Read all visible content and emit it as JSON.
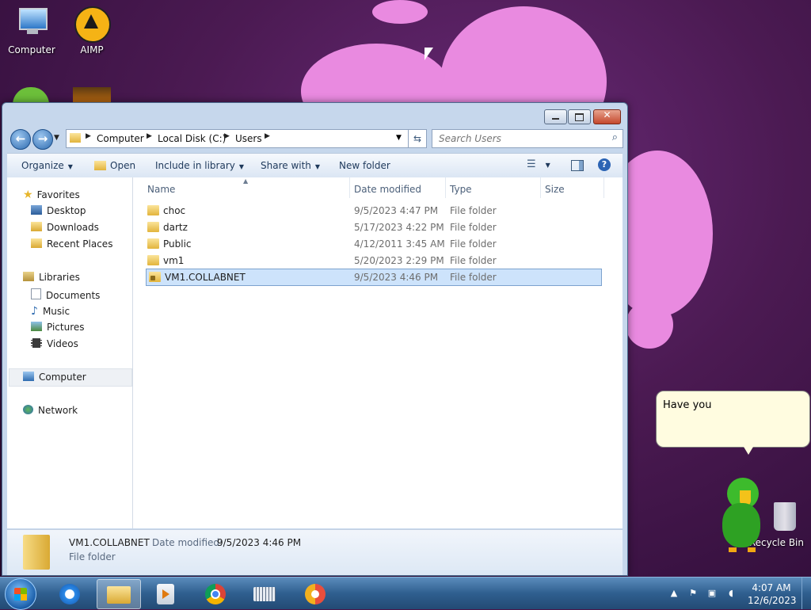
{
  "desktop": {
    "icons": [
      {
        "label": "Computer",
        "icon": "computer-icon"
      },
      {
        "label": "AIMP",
        "icon": "aimp-icon"
      },
      {
        "label": "Recycle Bin",
        "icon": "recycle-bin-icon"
      }
    ],
    "assistant_bubble": "Have you"
  },
  "window": {
    "breadcrumbs": [
      "Computer",
      "Local Disk (C:)",
      "Users"
    ],
    "search_placeholder": "Search Users",
    "toolbar": {
      "organize": "Organize",
      "open": "Open",
      "include_in_library": "Include in library",
      "share_with": "Share with",
      "new_folder": "New folder"
    },
    "nav": {
      "favorites": "Favorites",
      "favorites_items": [
        "Desktop",
        "Downloads",
        "Recent Places"
      ],
      "libraries": "Libraries",
      "libraries_items": [
        "Documents",
        "Music",
        "Pictures",
        "Videos"
      ],
      "computer": "Computer",
      "network": "Network"
    },
    "columns": [
      "Name",
      "Date modified",
      "Type",
      "Size"
    ],
    "rows": [
      {
        "name": "choc",
        "date": "9/5/2023 4:47 PM",
        "type": "File folder",
        "locked": false
      },
      {
        "name": "dartz",
        "date": "5/17/2023 4:22 PM",
        "type": "File folder",
        "locked": false
      },
      {
        "name": "Public",
        "date": "4/12/2011 3:45 AM",
        "type": "File folder",
        "locked": false
      },
      {
        "name": "vm1",
        "date": "5/20/2023 2:29 PM",
        "type": "File folder",
        "locked": false
      },
      {
        "name": "VM1.COLLABNET",
        "date": "9/5/2023 4:46 PM",
        "type": "File folder",
        "locked": true,
        "selected": true
      }
    ],
    "details": {
      "name": "VM1.COLLABNET",
      "date_label": "Date modified:",
      "date_value": "9/5/2023 4:46 PM",
      "type": "File folder"
    }
  },
  "taskbar": {
    "apps": [
      "internet-explorer-icon",
      "windows-explorer-icon",
      "media-player-icon",
      "chrome-icon",
      "keyboard-icon",
      "vpn-icon"
    ],
    "clock": {
      "time": "4:07 AM",
      "date": "12/6/2023"
    }
  },
  "colors": {
    "selection": "#cde3fb",
    "wallpaper_pink": "#e98ae0",
    "taskbar": "#2f5f8f"
  }
}
